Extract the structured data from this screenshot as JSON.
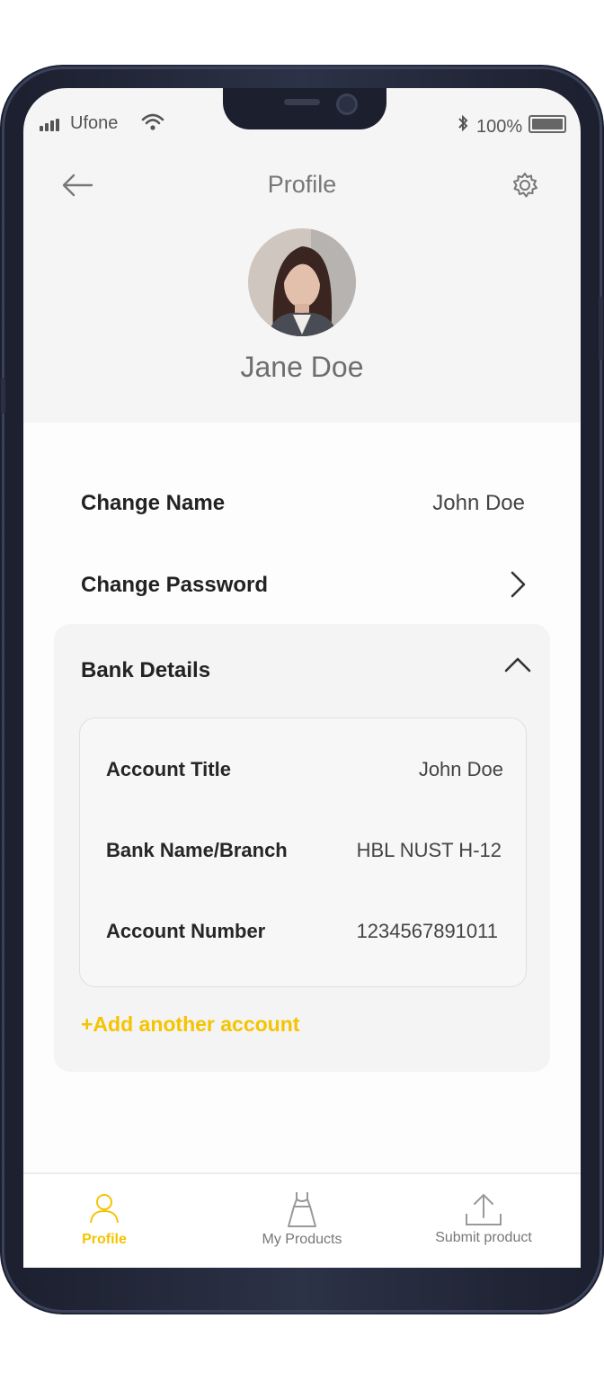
{
  "status_bar": {
    "carrier": "Ufone",
    "battery_percent": "100%",
    "icons": [
      "signal-icon",
      "wifi-icon",
      "bluetooth-icon",
      "battery-icon"
    ]
  },
  "header": {
    "title": "Profile",
    "back_icon": "arrow-left-icon",
    "settings_icon": "gear-icon"
  },
  "profile": {
    "name": "Jane Doe"
  },
  "settings": {
    "change_name": {
      "label": "Change Name",
      "value": "John Doe"
    },
    "change_password": {
      "label": "Change Password",
      "icon": "chevron-right-icon"
    },
    "bank_details": {
      "label": "Bank Details",
      "expanded": true,
      "icon": "chevron-up-icon"
    }
  },
  "bank_account": {
    "rows": [
      {
        "label": "Account Title",
        "value": "John Doe"
      },
      {
        "label": "Bank Name/Branch",
        "value": "HBL NUST H-12"
      },
      {
        "label": "Account Number",
        "value": "1234567891011"
      }
    ],
    "add_link": "+Add another account"
  },
  "tabbar": {
    "tabs": [
      {
        "label": "Profile",
        "icon": "user-icon",
        "active": true
      },
      {
        "label": "My Products",
        "icon": "dress-icon",
        "active": false
      },
      {
        "label": "Submit product",
        "icon": "upload-icon",
        "active": false
      }
    ]
  },
  "colors": {
    "accent": "#f5c400",
    "screen_bg": "#f5f5f5",
    "frame": "#1b1f2e"
  }
}
